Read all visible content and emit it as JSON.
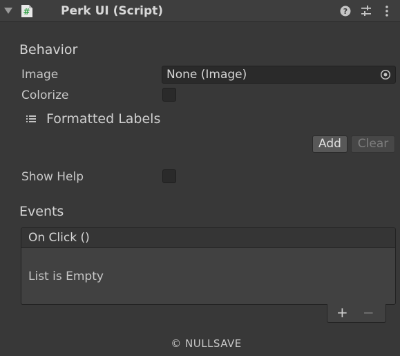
{
  "header": {
    "title": "Perk UI (Script)",
    "icons": [
      "foldout-arrow-icon",
      "script-icon",
      "help-icon",
      "presets-icon",
      "more-menu-icon"
    ]
  },
  "behavior": {
    "section_title": "Behavior",
    "image_label": "Image",
    "image_value": "None (Image)",
    "colorize_label": "Colorize",
    "colorize_checked": false,
    "formatted_labels_label": "Formatted Labels",
    "add_label": "Add",
    "clear_label": "Clear",
    "show_help_label": "Show Help",
    "show_help_checked": false
  },
  "events": {
    "section_title": "Events",
    "on_click_label": "On Click ()",
    "empty_text": "List is Empty",
    "add_symbol": "+",
    "remove_symbol": "−"
  },
  "footer": {
    "copyright": "© NULLSAVE"
  },
  "colors": {
    "background": "#383838",
    "header": "#3e3e3e",
    "field": "#2a2a2a",
    "script_icon": "#2f9e44"
  }
}
